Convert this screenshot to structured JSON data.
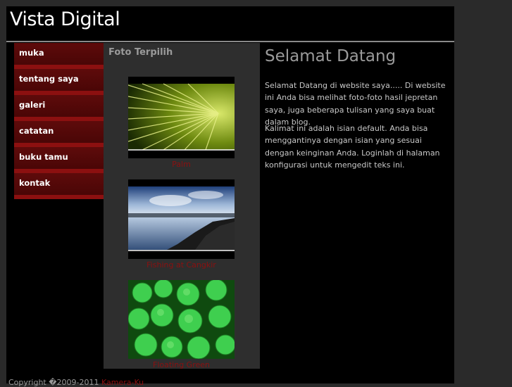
{
  "header": {
    "site_title": "Vista Digital"
  },
  "nav": {
    "items": [
      {
        "label": "muka"
      },
      {
        "label": "tentang saya"
      },
      {
        "label": "galeri"
      },
      {
        "label": "catatan"
      },
      {
        "label": "buku tamu"
      },
      {
        "label": "kontak"
      }
    ]
  },
  "featured": {
    "title": "Foto Terpilih",
    "photos": [
      {
        "caption": "Palm"
      },
      {
        "caption": "Fishing at Cangkir"
      },
      {
        "caption": "Floating Green"
      }
    ]
  },
  "welcome": {
    "title": "Selamat Datang",
    "paragraph1": "Selamat Datang di website saya..... Di website ini Anda bisa melihat foto-foto hasil jepretan saya, juga beberapa tulisan yang saya buat dalam blog.",
    "paragraph2": "Kalimat ini adalah isian default. Anda bisa menggantinya dengan isian yang sesuai dengan keinginan Anda. Loginlah di halaman konfigurasi untuk mengedit teks ini."
  },
  "footer": {
    "copyright": "Copyright �2009-2011 ",
    "link": "Kamera-Ku"
  },
  "colors": {
    "background": "#000000",
    "nav_item": "#5e0b0b",
    "nav_accent": "#8c1010",
    "heading_gray": "#9a9a9a"
  }
}
